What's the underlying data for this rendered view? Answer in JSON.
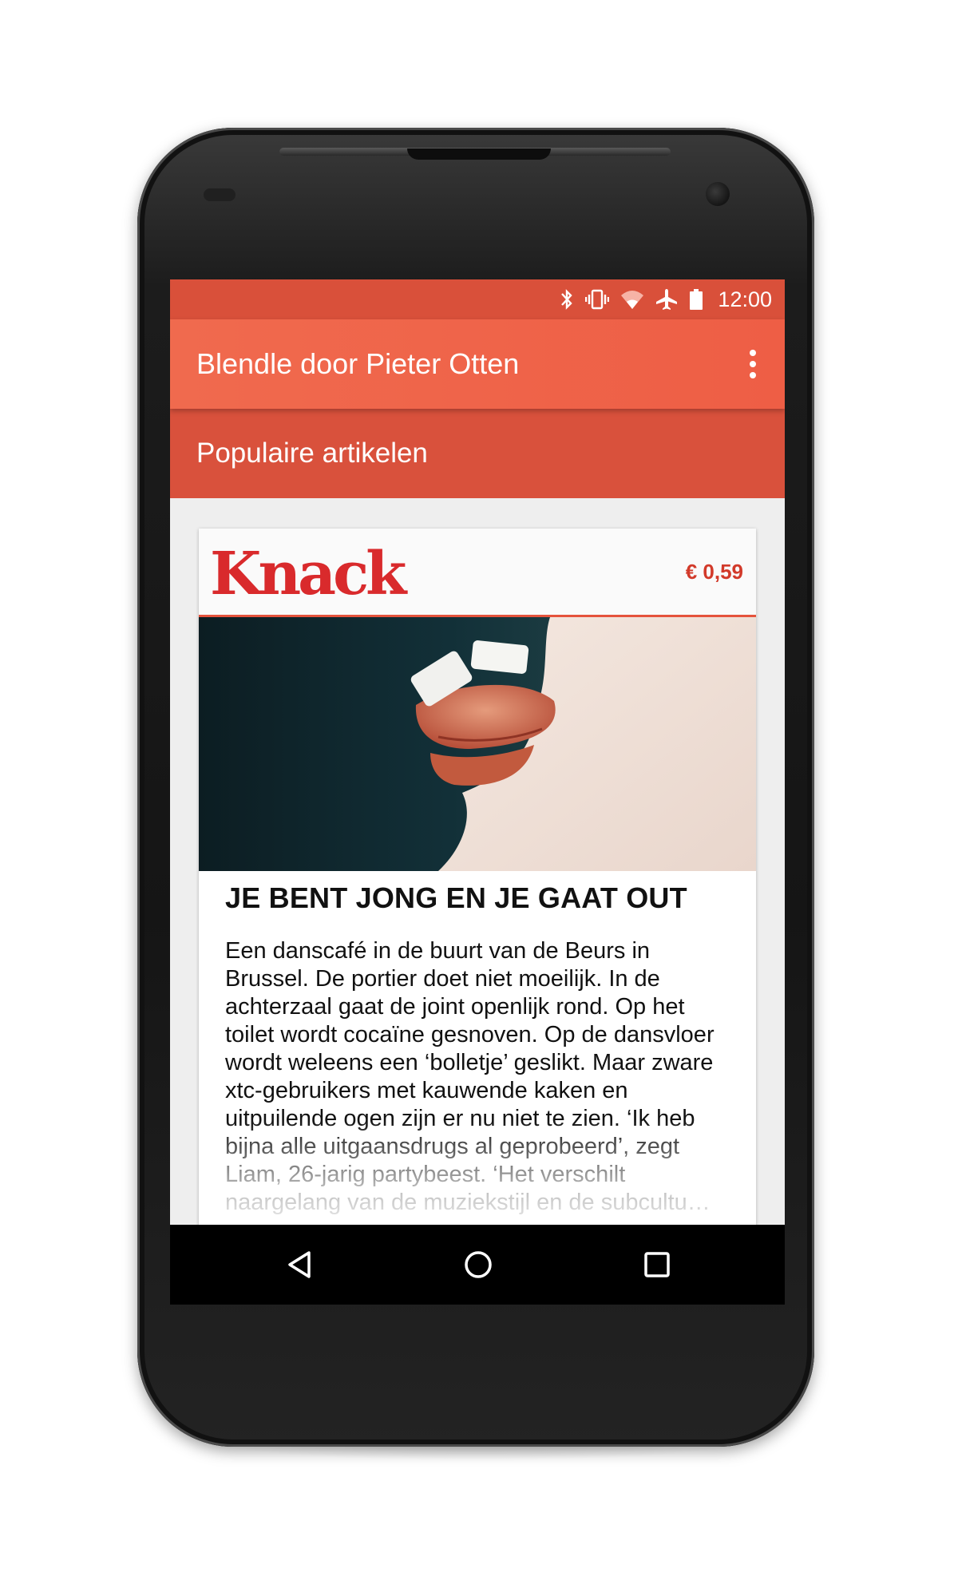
{
  "status_bar": {
    "time": "12:00",
    "icons": [
      "bluetooth-icon",
      "vibrate-icon",
      "wifi-icon",
      "airplane-icon",
      "battery-icon"
    ]
  },
  "app_bar": {
    "title": "Blendle door Pieter Otten",
    "menu_icon": "overflow-menu-icon"
  },
  "section": {
    "title": "Populaire artikelen"
  },
  "article": {
    "publication": "Knack",
    "price": "€ 0,59",
    "title": "JE BENT JONG EN JE GAAT OUT",
    "body": "Een danscafé in de buurt van de Beurs in Brussel. De portier doet niet moeilijk. In de achterzaal gaat de joint openlijk rond. Op het toilet wordt cocaïne gesnoven. Op de dansvloer wordt weleens een ‘bolletje’ geslikt. Maar zware xtc-gebruikers met kauwende kaken en uitpuilende ogen zijn er nu niet te zien. ‘Ik heb bijna alle uitgaansdrugs al geprobeerd’, zegt Liam, 26-jarig partybeest. ‘Het verschilt naargelang van de muziekstijl en de subcultu…"
  },
  "nav_bar": {
    "back_icon": "back-icon",
    "home_icon": "home-icon",
    "recents_icon": "recents-icon"
  },
  "colors": {
    "app_bar": "#ee5e45",
    "status_bar": "#d9503a",
    "section_bar": "#d9513c",
    "brand_red": "#d92a2c"
  }
}
